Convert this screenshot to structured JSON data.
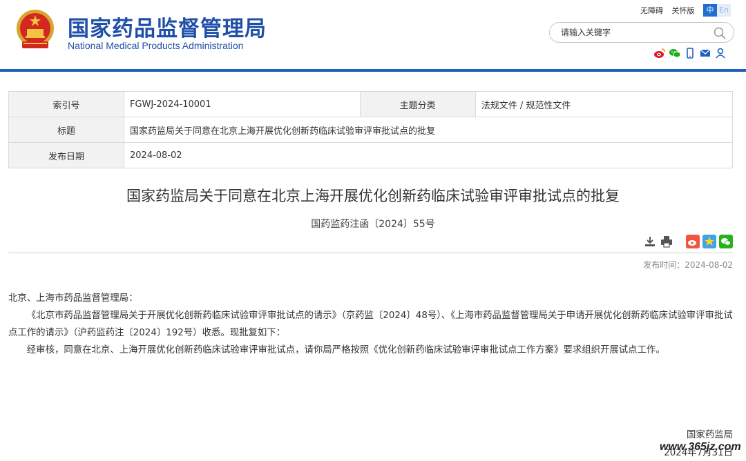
{
  "header": {
    "site_name_cn": "国家药品监督管理局",
    "site_name_en": "National Medical Products Administration",
    "top_links": [
      "无障碍",
      "关怀版"
    ],
    "lang_zh": "中",
    "lang_en": "En",
    "search_placeholder": "请输入关键字",
    "social_icons": [
      "weibo-icon",
      "wechat-icon",
      "mobile-icon",
      "mail-icon",
      "user-icon"
    ],
    "brand_color": "#1f4fa8",
    "bar_color": "#1f5fbf"
  },
  "meta": {
    "index_label": "索引号",
    "index_value": "FGWJ-2024-10001",
    "category_label": "主题分类",
    "category_value": "法规文件 / 规范性文件",
    "title_label": "标题",
    "title_value": "国家药监局关于同意在北京上海开展优化创新药临床试验审评审批试点的批复",
    "date_label": "发布日期",
    "date_value": "2024-08-02"
  },
  "article": {
    "title": "国家药监局关于同意在北京上海开展优化创新药临床试验审评审批试点的批复",
    "doc_number": "国药监药注函〔2024〕55号",
    "tool_icons": [
      "download-icon",
      "print-icon",
      "weibo-share-icon",
      "qzone-share-icon",
      "wechat-share-icon"
    ],
    "pub_time": "发布时间：2024-08-02",
    "salutation": "北京、上海市药品监督管理局：",
    "para1": "《北京市药品监督管理局关于开展优化创新药临床试验审评审批试点的请示》（京药监〔2024〕48号）、《上海市药品监督管理局关于申请开展优化创新药临床试验审评审批试点工作的请示》（沪药监药注〔2024〕192号）收悉。现批复如下：",
    "para2": "经审核，同意在北京、上海开展优化创新药临床试验审评审批试点，请你局严格按照《优化创新药临床试验审评审批试点工作方案》要求组织开展试点工作。",
    "sign_org": "国家药监局",
    "sign_date": "2024年7月31日"
  },
  "watermark": "www.365jz.com"
}
